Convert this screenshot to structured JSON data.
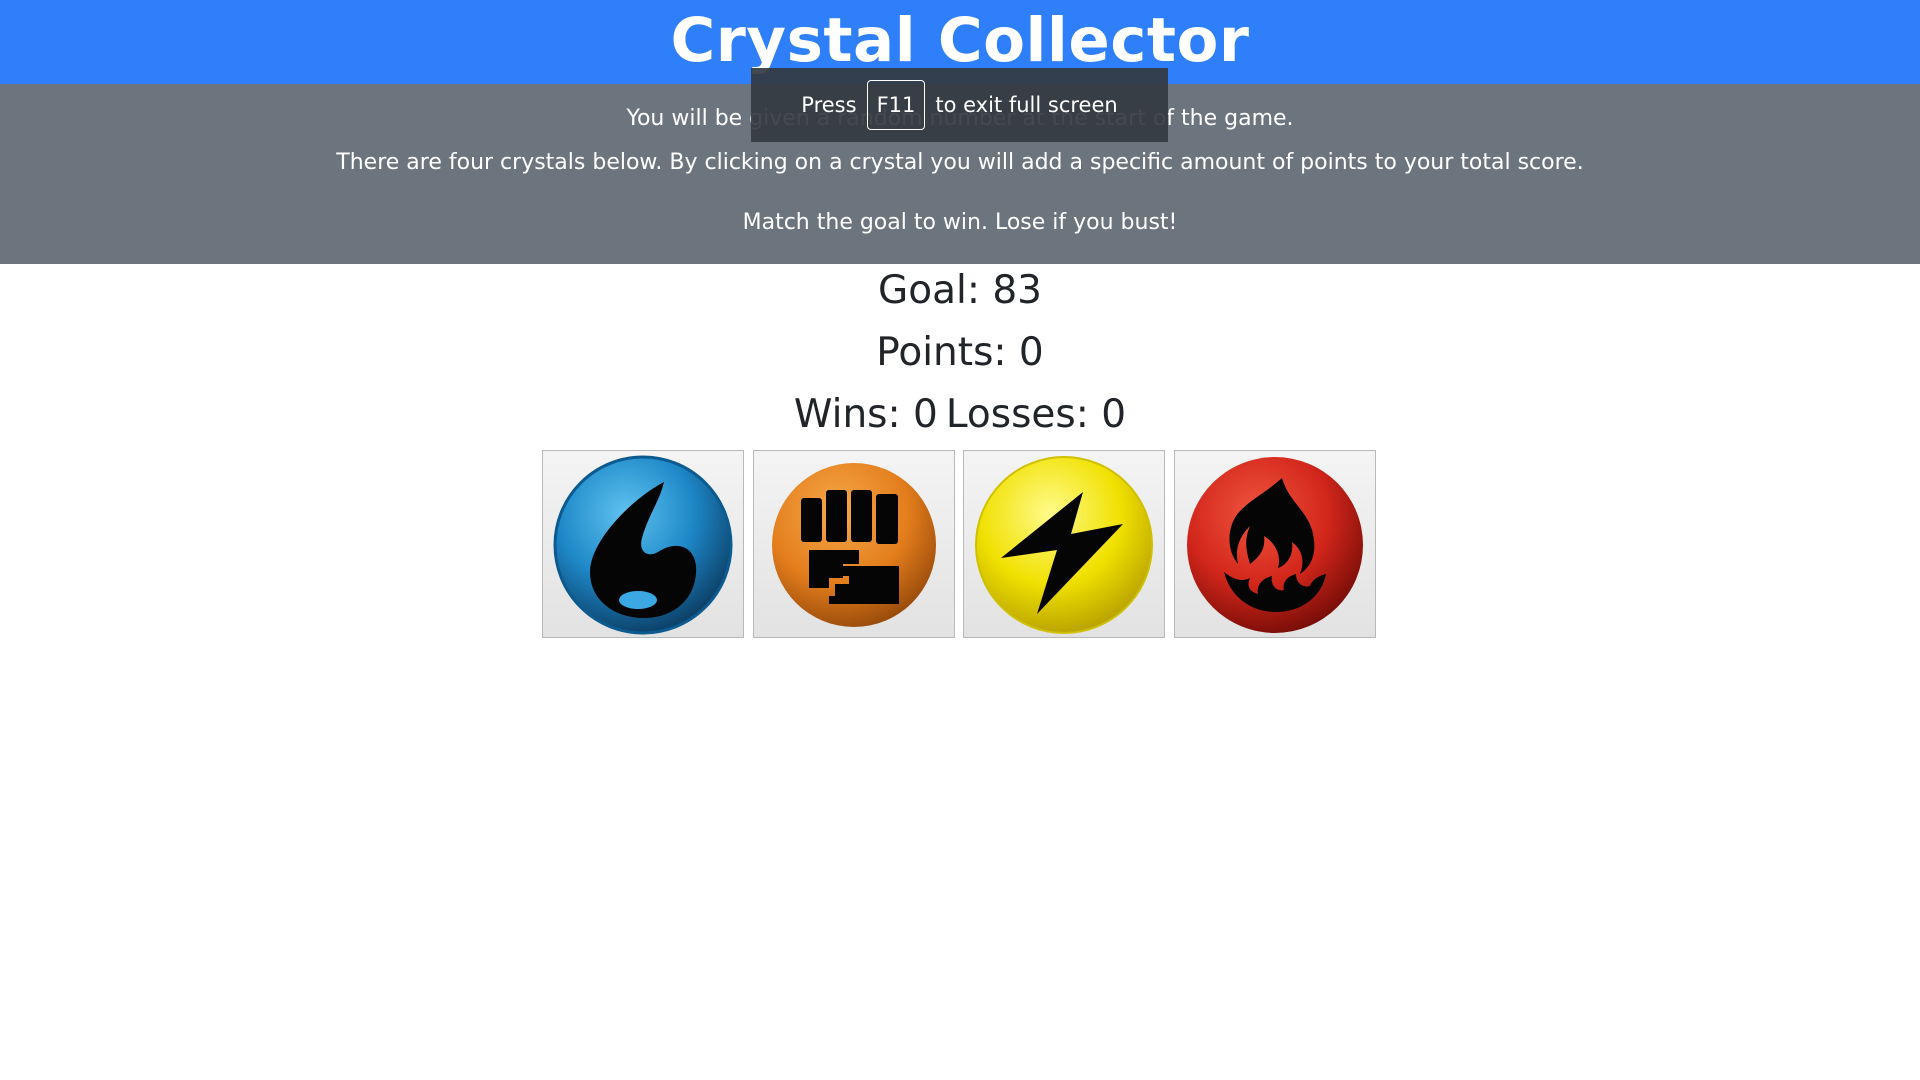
{
  "header": {
    "title": "Crystal Collector",
    "color": "#2f7ffb"
  },
  "instructions": {
    "line1": "You will be given a random number at the start of the game.",
    "line2": "There are four crystals below. By clicking on a crystal you will add a specific amount of points to your total score.",
    "line3": "Match the goal to win. Lose if you bust!",
    "background": "#6c757d"
  },
  "fullscreen_notice": {
    "prefix": "Press",
    "key": "F11",
    "suffix": "to exit full screen"
  },
  "scoreboard": {
    "goal": "Goal: 83",
    "points": "Points: 0",
    "wins": "Wins: 0",
    "losses": "Losses: 0"
  },
  "crystals": [
    {
      "icon": "water-drop-icon",
      "color": "#1e88c8"
    },
    {
      "icon": "fist-icon",
      "color": "#e37d1c"
    },
    {
      "icon": "lightning-icon",
      "color": "#f0e000"
    },
    {
      "icon": "flame-icon",
      "color": "#d2261b"
    }
  ]
}
